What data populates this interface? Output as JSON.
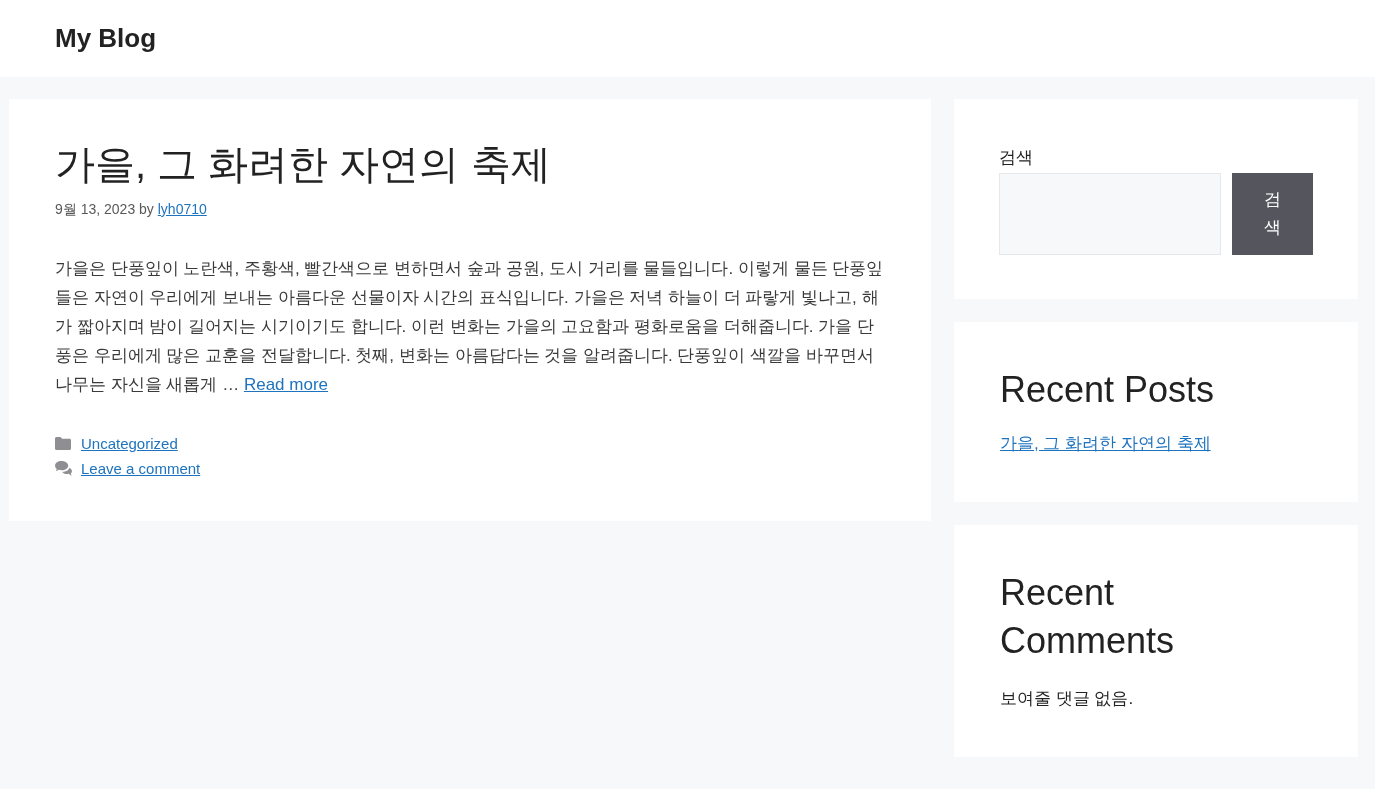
{
  "site_title": "My Blog",
  "post": {
    "title": "가을, 그 화려한 자연의 축제",
    "date": "9월 13, 2023",
    "by": "by",
    "author": "lyh0710",
    "excerpt": "가을은 단풍잎이 노란색, 주황색, 빨간색으로 변하면서 숲과 공원, 도시 거리를 물들입니다. 이렇게 물든 단풍잎들은 자연이 우리에게 보내는 아름다운 선물이자 시간의 표식입니다. 가을은 저녁 하늘이 더 파랗게 빛나고, 해가 짧아지며 밤이 길어지는 시기이기도 합니다. 이런 변화는 가을의 고요함과 평화로움을 더해줍니다. 가을 단풍은 우리에게 많은 교훈을 전달합니다. 첫째, 변화는 아름답다는 것을 알려줍니다. 단풍잎이 색깔을 바꾸면서 나무는 자신을 새롭게 …",
    "read_more": "Read more",
    "category": "Uncategorized",
    "comment_link": "Leave a comment"
  },
  "sidebar": {
    "search": {
      "label": "검색",
      "button": "검색"
    },
    "recent_posts": {
      "title": "Recent Posts",
      "items": [
        "가을, 그 화려한 자연의 축제"
      ]
    },
    "recent_comments": {
      "title": "Recent Comments",
      "empty": "보여줄 댓글 없음."
    }
  }
}
